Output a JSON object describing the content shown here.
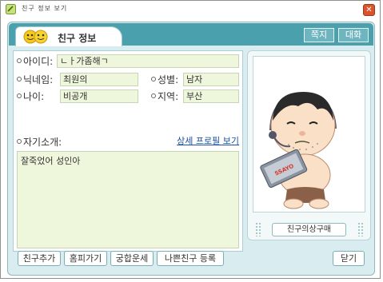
{
  "window": {
    "title": "친구 정보 보기"
  },
  "tab": {
    "label": "친구 정보"
  },
  "header_buttons": {
    "note": "쪽지",
    "chat": "대화"
  },
  "profile": {
    "id_label": "아이디:",
    "id_value": "ㄴㅏ가좀해ㄱ",
    "nickname_label": "닉네임:",
    "nickname_value": "최원의",
    "gender_label": "성별:",
    "gender_value": "남자",
    "age_label": "나이:",
    "age_value": "비공개",
    "region_label": "지역:",
    "region_value": "부산",
    "intro_label": "자기소개:",
    "detail_link": "상세 프로필 보기",
    "intro_text": "잘죽었어 성인아"
  },
  "avatar": {
    "buy_button": "친구의상구매",
    "laptop_text": "SSAYO"
  },
  "footer": {
    "add_friend": "친구추가",
    "homepage": "홈피가기",
    "compatibility": "궁합운세",
    "block_friend": "나쁜친구 등록",
    "close": "닫기"
  },
  "colors": {
    "header": "#4aa1ad",
    "panel": "#d9edf0",
    "field": "#eef6dc",
    "link": "#1a4fa0"
  }
}
